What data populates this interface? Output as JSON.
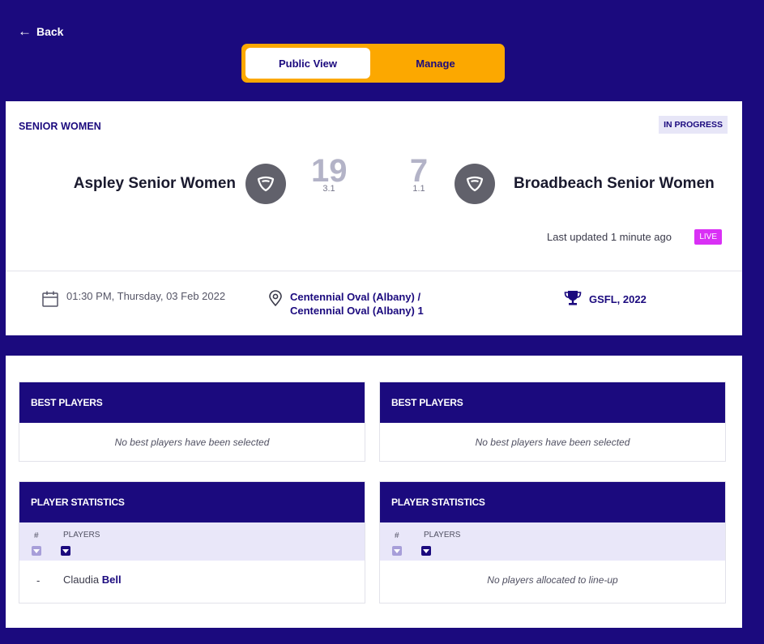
{
  "nav": {
    "back_label": "Back"
  },
  "view_toggle": {
    "options": [
      "Public View",
      "Manage"
    ],
    "active": "Public View"
  },
  "match": {
    "division": "SENIOR WOMEN",
    "status": "IN PROGRESS",
    "home": {
      "name": "Aspley Senior Women",
      "score": "19",
      "breakdown": "3.1"
    },
    "away": {
      "name": "Broadbeach Senior Women",
      "score": "7",
      "breakdown": "1.1"
    },
    "last_updated": "Last updated 1 minute ago",
    "live_label": "LIVE",
    "datetime": "01:30 PM, Thursday, 03 Feb 2022",
    "venue_line1": "Centennial Oval (Albany) /",
    "venue_line2": "Centennial Oval (Albany) 1",
    "competition": "GSFL, 2022"
  },
  "best_players": {
    "title": "BEST PLAYERS",
    "home_empty": "No best players have been selected",
    "away_empty": "No best players have been selected"
  },
  "player_stats": {
    "title": "PLAYER STATISTICS",
    "col_num": "#",
    "col_players": "PLAYERS",
    "home_rows": [
      {
        "num": "-",
        "first": "Claudia",
        "last": "Bell"
      }
    ],
    "away_empty": "No players allocated to line-up"
  },
  "colors": {
    "brand_navy": "#1b0a7e",
    "toggle_orange": "#fca800",
    "live_purple": "#d930f5",
    "crest_gray": "#61616b"
  },
  "icons": {
    "back": "arrow-left-icon",
    "crest": "shield-icon",
    "date": "calendar-icon",
    "venue": "location-pin-icon",
    "competition": "trophy-icon",
    "sort": "chevron-down-icon"
  }
}
